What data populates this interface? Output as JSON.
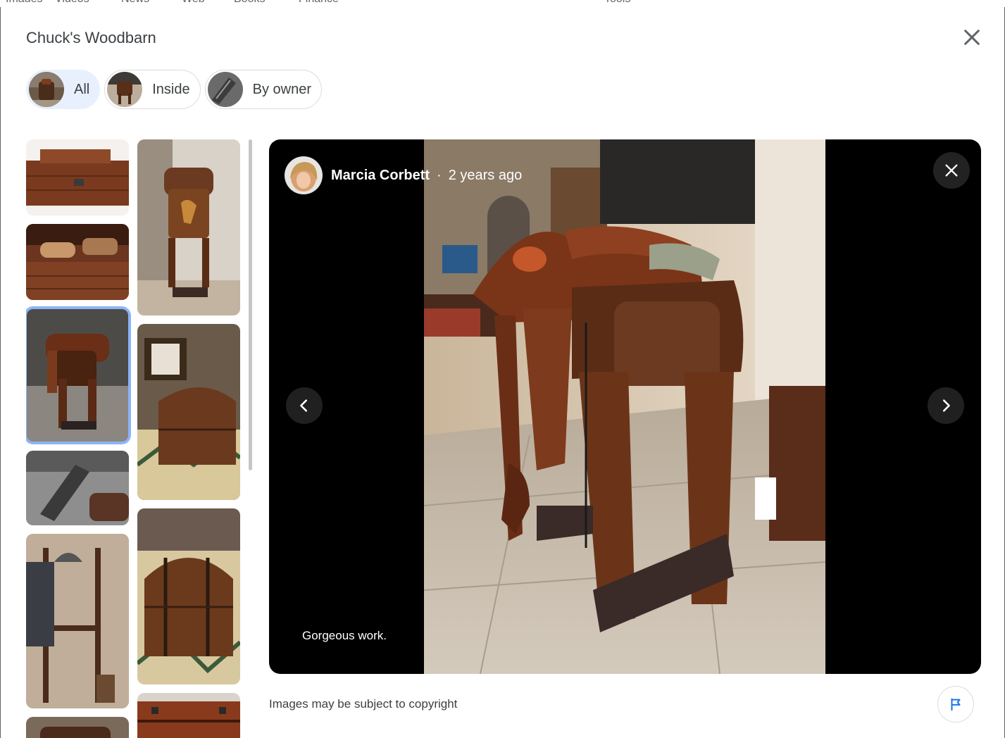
{
  "background_tabs": [
    "Images",
    "Videos",
    "News",
    "Web",
    "Books",
    "Finance",
    "Tools"
  ],
  "dialog": {
    "title": "Chuck's Woodbarn"
  },
  "filters": [
    {
      "label": "All",
      "active": true
    },
    {
      "label": "Inside",
      "active": false
    },
    {
      "label": "By owner",
      "active": false
    }
  ],
  "viewer": {
    "author": "Marcia Corbett",
    "separator": "·",
    "age": "2 years ago",
    "caption": "Gorgeous work."
  },
  "footer": {
    "copyright": "Images may be subject to copyright"
  },
  "colors": {
    "accent": "#1a73e8",
    "chip_active": "#e8f0fe",
    "selected_outline": "#8ab4f8"
  }
}
